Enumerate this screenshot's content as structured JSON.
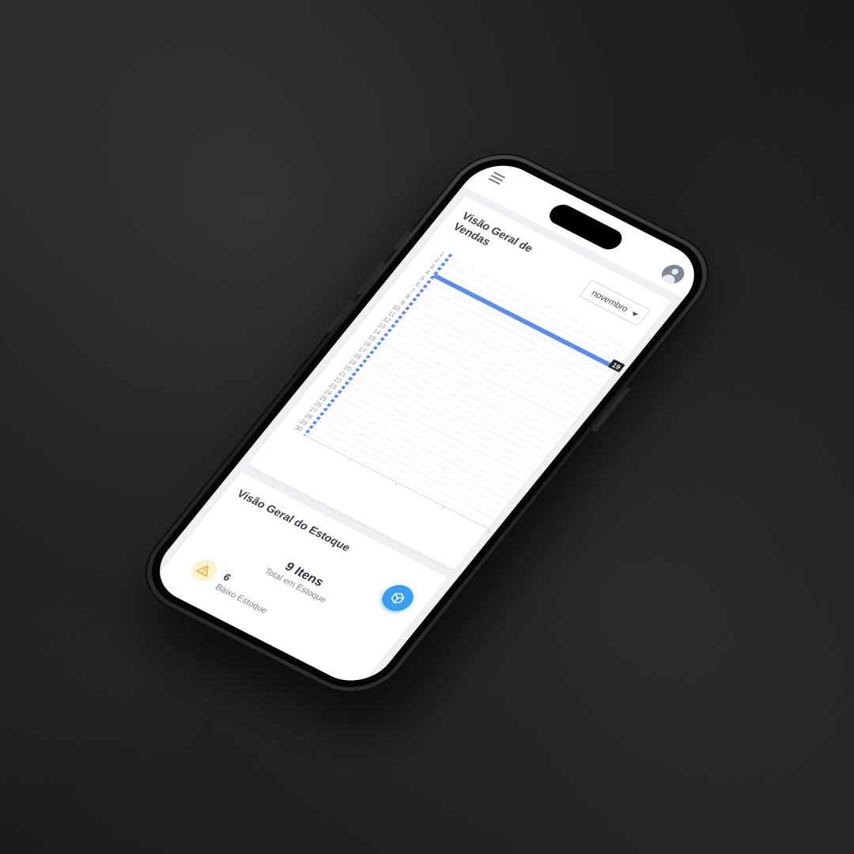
{
  "sales": {
    "title": "Visão Geral de Vendas",
    "month_select": "novembro"
  },
  "chart_data": {
    "type": "bar",
    "orientation": "horizontal",
    "categories": [
      "1",
      "2",
      "3",
      "4",
      "5",
      "6",
      "7",
      "8",
      "9",
      "10",
      "11",
      "12",
      "13",
      "14",
      "15",
      "16",
      "17",
      "18",
      "19",
      "20",
      "21",
      "22",
      "23",
      "24",
      "25",
      "26",
      "27",
      "28",
      "29",
      "30"
    ],
    "series": [
      {
        "values": [
          0,
          0,
          0,
          19,
          0,
          0,
          0,
          0,
          0,
          0,
          0,
          0,
          0,
          0,
          0,
          0,
          0,
          0,
          0,
          0,
          0,
          0,
          0,
          0,
          0,
          0,
          0,
          0,
          0,
          0
        ]
      }
    ],
    "highlight_label": "19",
    "xlim": [
      0,
      20
    ],
    "grid": true,
    "colors": {
      "bar": "#5b8def",
      "axis": "#5b8def",
      "label_bg": "#222222"
    }
  },
  "stock": {
    "title": "Visão Geral do Estoque",
    "total_value": "9 Itens",
    "total_label": "Total em Estoque",
    "low_value": "6",
    "low_label": "Baixo Estoque",
    "colors": {
      "accent": "#3a9ef2",
      "warn_bg": "#fdf2cf",
      "warn": "#e8a93a"
    }
  }
}
